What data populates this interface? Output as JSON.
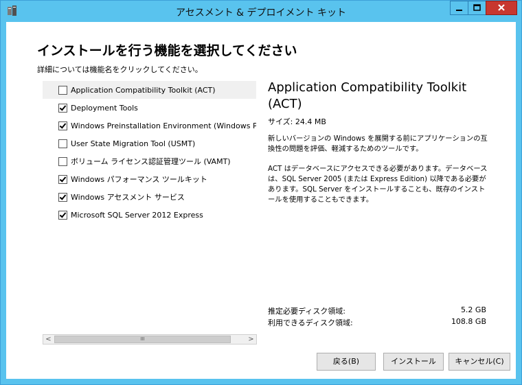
{
  "window": {
    "title": "アセスメント & デプロイメント キット",
    "controls": {
      "minimize_icon": "minimize-icon",
      "maximize_icon": "maximize-icon",
      "close_icon": "close-icon"
    }
  },
  "page": {
    "heading": "インストールを行う機能を選択してください",
    "subtext": "詳細については機能名をクリックしてください。"
  },
  "features": [
    {
      "label": "Application Compatibility Toolkit (ACT)",
      "checked": false,
      "selected": true
    },
    {
      "label": "Deployment Tools",
      "checked": true,
      "selected": false
    },
    {
      "label": "Windows Preinstallation Environment (Windows PE",
      "checked": true,
      "selected": false
    },
    {
      "label": "User State Migration Tool (USMT)",
      "checked": false,
      "selected": false
    },
    {
      "label": "ボリューム ライセンス認証管理ツール (VAMT)",
      "checked": false,
      "selected": false
    },
    {
      "label": "Windows パフォーマンス ツールキット",
      "checked": true,
      "selected": false
    },
    {
      "label": "Windows アセスメント サービス",
      "checked": true,
      "selected": false
    },
    {
      "label": "Microsoft SQL Server 2012 Express",
      "checked": true,
      "selected": false
    }
  ],
  "scrollbar": {
    "left": "<",
    "right": ">",
    "thumb": "III"
  },
  "detail": {
    "title": "Application Compatibility Toolkit (ACT)",
    "size": "サイズ: 24.4 MB",
    "description": "新しいバージョンの Windows を展開する前にアプリケーションの互換性の問題を評価、軽減するためのツールです。",
    "note": "ACT はデータベースにアクセスできる必要があります。データベースは、SQL Server 2005 (または Express Edition) 以降である必要があります。SQL Server をインストールすることも、既存のインストールを使用することもできます。"
  },
  "disk": {
    "required_label": "推定必要ディスク領域:",
    "required_value": "5.2 GB",
    "available_label": "利用できるディスク領域:",
    "available_value": "108.8 GB"
  },
  "buttons": {
    "back": "戻る(B)",
    "install": "インストール",
    "cancel": "キャンセル(C)"
  },
  "colors": {
    "titlebar": "#59c3ee",
    "close": "#c7372f"
  }
}
